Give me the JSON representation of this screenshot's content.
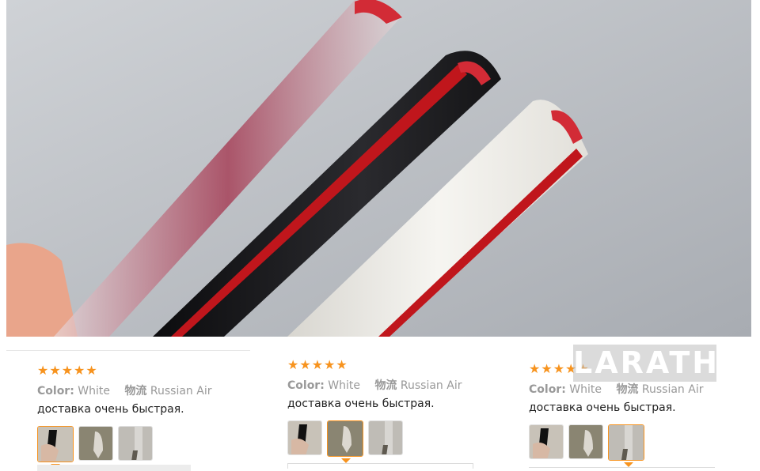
{
  "reviews": [
    {
      "rating": 5,
      "color_label": "Color:",
      "color_value": "White",
      "shipping_label": "物流",
      "shipping_value": "Russian Air",
      "text": "доставка очень быстрая.",
      "selected_thumb": 0
    },
    {
      "rating": 5,
      "color_label": "Color:",
      "color_value": "White",
      "shipping_label": "物流",
      "shipping_value": "Russian Air",
      "text": "доставка очень быстрая.",
      "selected_thumb": 1
    },
    {
      "rating": 5,
      "color_label": "Color:",
      "color_value": "White",
      "shipping_label": "物流",
      "shipping_value": "Russian Air",
      "text": "доставка очень быстрая.",
      "selected_thumb": 2
    }
  ],
  "watermark": "LARATH",
  "colors": {
    "star": "#f7931e",
    "selected_border": "#f7931e",
    "strip_red": "#c0161c",
    "strip_black": "#1d1d1f",
    "strip_white": "#efeeea"
  }
}
